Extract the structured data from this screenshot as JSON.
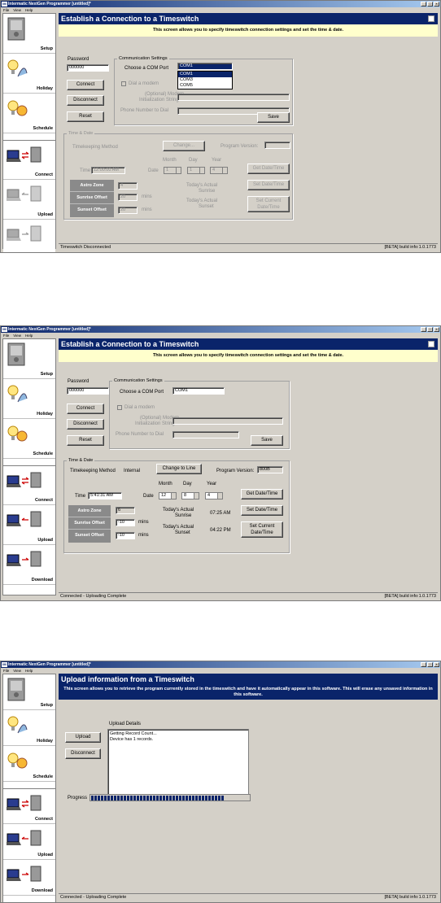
{
  "app": {
    "title": "Intermatic NextGen Programmer [untitled]*",
    "menu": [
      "File",
      "View",
      "Help"
    ]
  },
  "sidebar": {
    "setup": "Setup",
    "holiday": "Holiday",
    "schedule": "Schedule",
    "connect": "Connect",
    "upload": "Upload",
    "download": "Download"
  },
  "connect_screen": {
    "title": "Establish a Connection to a Timeswitch",
    "subtitle": "This screen allows you to specify timeswitch connection settings and set the time & date.",
    "password_label": "Password",
    "password_value": "000000",
    "connect_btn": "Connect",
    "disconnect_btn": "Disconnect",
    "reset_btn": "Reset",
    "comm_group": "Communication Settings",
    "com_port_label": "Choose a COM Port",
    "com_port_value": "COM1",
    "com_options": [
      "COM1",
      "COM3",
      "COM5"
    ],
    "dial_modem": "Dial a modem",
    "modem_init_label_1": "(Optional) Modem",
    "modem_init_label_2": "Initialization String",
    "phone_label": "Phone Number to Dial",
    "save_btn": "Save",
    "time_group": "Time & Date",
    "timekeeping_label": "Timekeeping Method",
    "change_btn": "Change...",
    "change_to_line_btn": "Change to Line",
    "program_version_label": "Program Version:",
    "month_label": "Month",
    "day_label": "Day",
    "year_label": "Year",
    "time_label": "Time",
    "date_label": "Date",
    "get_date_btn": "Get Date/Time",
    "set_date_btn": "Set Date/Time",
    "set_current_btn_1": "Set Current",
    "set_current_btn_2": "Date/Time",
    "astro_zone": "Astro Zone",
    "sunrise_offset": "Sunrise Offset",
    "sunset_offset": "Sunset Offset",
    "mins": "mins",
    "sunrise_label_1": "Today's Actual",
    "sunrise_label_2": "Sunrise",
    "sunset_label_1": "Today's Actual",
    "sunset_label_2": "Sunset",
    "build_info": "[BETA] build info:1.0.1773"
  },
  "shot1": {
    "time_value": "12:00:00 AM",
    "month": "1",
    "day": "1",
    "year": "4",
    "astro_value": "4",
    "sunrise_offset_value": "20",
    "sunset_offset_value": "20",
    "status": "Timeswitch Disconnected"
  },
  "shot2": {
    "timekeeping_value": "Internal",
    "program_version_value": "800B",
    "time_value": "5:41:31 AM",
    "month": "12",
    "day": "8",
    "year": "4",
    "astro_value": "6",
    "sunrise_offset_value": "-10",
    "sunset_offset_value": "-10",
    "sunrise_time": "07:25 AM",
    "sunset_time": "04:22 PM",
    "status": "Connected - Uploading Complete"
  },
  "shot3": {
    "title": "Upload information from a Timeswitch",
    "subtitle": "This screen allows you to retrieve the program currently stored in the timeswitch and have it automatically appear in this software.  This will erase any unsaved information in this software.",
    "upload_btn": "Upload",
    "disconnect_btn": "Disconnect",
    "details_label": "Upload Details",
    "details_lines": [
      "Getting Record Count...",
      "Device has 1 records."
    ],
    "progress_label": "Progress",
    "progress": 0.85,
    "status": "Connected - Uploading Complete"
  }
}
